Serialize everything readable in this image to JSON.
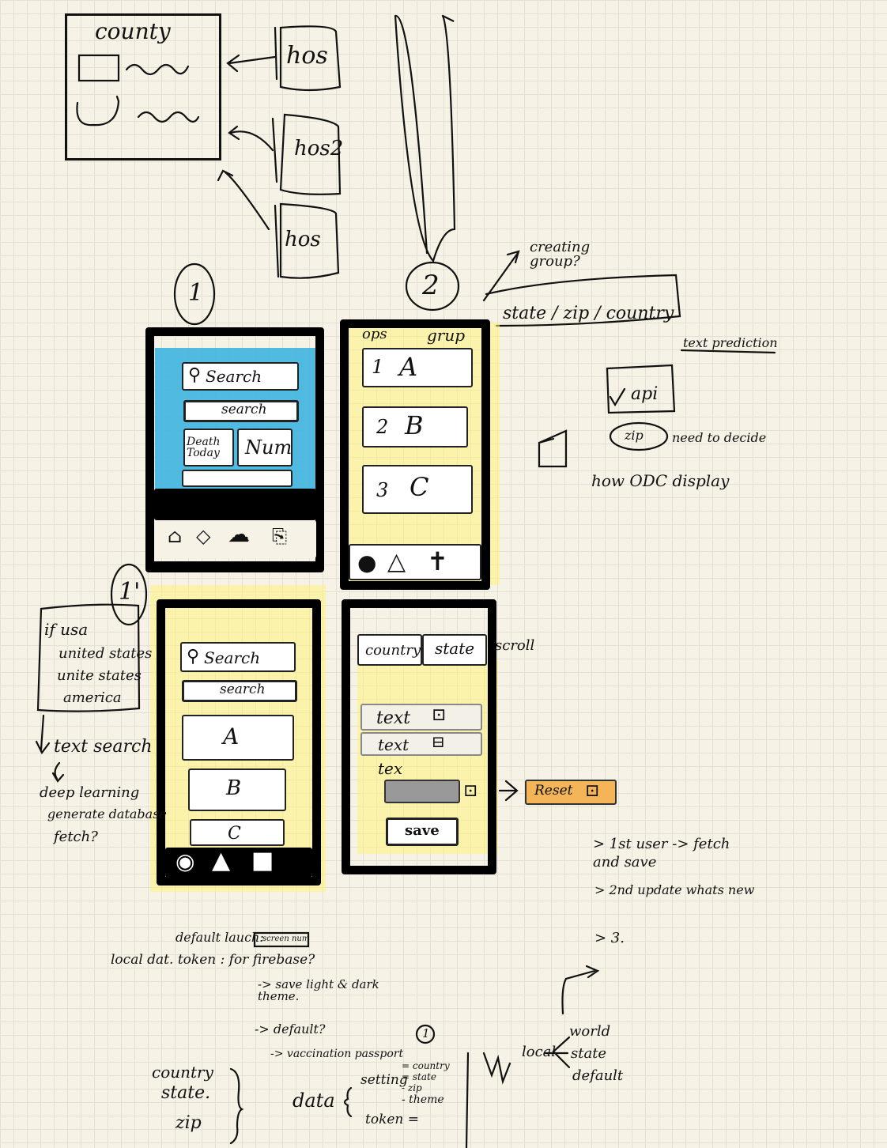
{
  "top_sketch": {
    "county_label": "county",
    "hos_labels": [
      "hos",
      "hos2",
      "hos"
    ]
  },
  "mockup1": {
    "number": "1",
    "search_box": "Search",
    "search_button": "search",
    "card_left": "Death Today",
    "card_right": "Num"
  },
  "mockup2": {
    "number": "2",
    "header": "grup",
    "items": [
      "A",
      "B",
      "C"
    ],
    "item_marks": [
      "1",
      "2",
      "3"
    ]
  },
  "mockup3": {
    "number": "1'",
    "search_box": "Search",
    "search_button": "search",
    "items": [
      "A",
      "B",
      "C"
    ]
  },
  "mockup4": {
    "tabs": [
      "country",
      "state"
    ],
    "tab_note": "scroll",
    "rows": [
      "text",
      "text",
      "tex"
    ],
    "save_button": "save",
    "callout": "Reset"
  },
  "notes": {
    "creating_group": "creating group?",
    "state_zip_country": "state / zip / country",
    "text_prediction": "text prediction",
    "api": "api",
    "zip": "zip",
    "need_to_decide": "need to decide",
    "how_odc_display": "how ODC display",
    "usa_box": [
      "if usa",
      "united states",
      "unite states",
      "america"
    ],
    "text_search": "text search",
    "deep_learning": [
      "deep learning",
      "generate database",
      "fetch?"
    ],
    "first_user": "> 1st user -> fetch and save",
    "second_update": "> 2nd update whats new",
    "third": "> 3.",
    "default_launch": "default lauch:",
    "screen_num": "screen num",
    "local_dat": "local dat.  token : for firebase?",
    "save_theme": "-> save light & dark theme.",
    "default_q": "-> default?",
    "vaccination": "-> vaccination passport",
    "circle_one": "1",
    "country_list": [
      "country",
      "state.",
      "zip"
    ],
    "data_label": "data",
    "data_items": [
      "setting",
      "token ="
    ],
    "setting_items": [
      "= country",
      "= state",
      "- zip",
      "- theme"
    ],
    "local_label": "local",
    "world_list": [
      "world",
      "state",
      "default"
    ]
  }
}
